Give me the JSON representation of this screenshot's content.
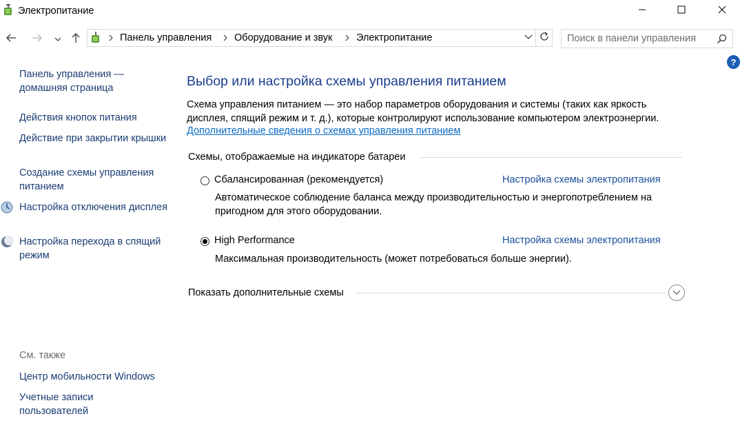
{
  "window": {
    "title": "Электропитание",
    "controls": {
      "minimize": "minimize-icon",
      "maximize": "maximize-icon",
      "close": "close-icon"
    }
  },
  "address": {
    "breadcrumbs": [
      "Панель управления",
      "Оборудование и звук",
      "Электропитание"
    ],
    "search_placeholder": "Поиск в панели управления"
  },
  "help": {
    "label": "?"
  },
  "sidebar": {
    "home_link": "Панель управления — домашняя страница",
    "items": [
      {
        "label": "Действия кнопок питания",
        "icon": ""
      },
      {
        "label": "Действие при закрытии крышки",
        "icon": ""
      },
      {
        "label": "Создание схемы управления питанием",
        "icon": ""
      },
      {
        "label": "Настройка отключения дисплея",
        "icon": "display-icon"
      },
      {
        "label": "Настройка перехода в спящий режим",
        "icon": "moon-icon"
      }
    ],
    "see_also_title": "См. также",
    "see_also": [
      "Центр мобильности Windows",
      "Учетные записи пользователей"
    ]
  },
  "main": {
    "title": "Выбор или настройка схемы управления питанием",
    "description": "Схема управления питанием — это набор параметров оборудования и системы (таких как яркость дисплея, спящий режим и т. д.), которые контролируют использование компьютером электроэнергии.",
    "more_info_link": "Дополнительные сведения о схемах управления питанием",
    "group_title": "Схемы, отображаемые на индикаторе батареи",
    "plans": [
      {
        "name": "Сбалансированная (рекомендуется)",
        "selected": false,
        "link": "Настройка схемы электропитания",
        "description": "Автоматическое соблюдение баланса между производительностью и энергопотреблением на пригодном для этого оборудовании."
      },
      {
        "name": "High Performance",
        "selected": true,
        "link": "Настройка схемы электропитания",
        "description": "Максимальная производительность (может потребоваться больше энергии)."
      }
    ],
    "show_more": "Показать дополнительные схемы"
  },
  "colors": {
    "link": "#1a3d73",
    "title": "#1a3d8f",
    "hyperlink": "#0b6bc4",
    "muted": "#6d6d6d",
    "help": "#1c5fb5"
  }
}
